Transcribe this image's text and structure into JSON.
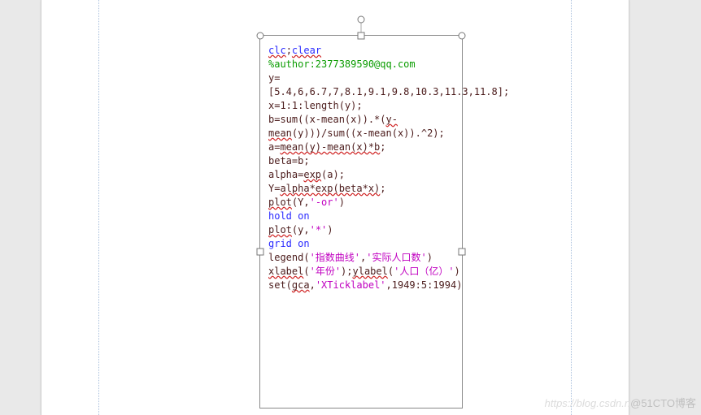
{
  "code": {
    "l1a": "clc",
    "l1b": ";",
    "l1c": "clear",
    "l2": "%author:2377389590@qq.com",
    "l3": "y=",
    "l4": "[5.4,6,6.7,7,8.1,9.1,9.8,10.3,11.3,11.8];",
    "l5a": "x=1:1:length(y);",
    "l6a": "b=sum((x-mean(x)).*(",
    "l6b": "y-mean",
    "l6c": "(y)))/sum((x-mean(x)).^2);",
    "l7a": "a=",
    "l7b": "mean(y)-mean(x)*b",
    "l7c": ";",
    "l8": "beta=b;",
    "l9a": "alpha=",
    "l9b": "exp",
    "l9c": "(a);",
    "l10a": "Y=",
    "l10b": "alpha*exp(beta*x)",
    "l10c": ";",
    "l11a_fn": "plot",
    "l11a_args": "(Y,",
    "l11a_str": "'-or'",
    "l11a_end": ")",
    "l12a": "hold ",
    "l12b": "on",
    "l13a_fn": "plot",
    "l13a_args": "(y,",
    "l13a_str": "'*'",
    "l13a_end": ")",
    "l14a": "grid ",
    "l14b": "on",
    "l15a": "legend(",
    "l15b": "'指数曲线'",
    "l15c": ",",
    "l15d": "'实际人口数'",
    "l15e": ")",
    "l16a": "xlabel",
    "l16b": "(",
    "l16c": "'年份'",
    "l16d": ");",
    "l16e": "ylabel",
    "l16f": "(",
    "l16g": "'人口（亿）'",
    "l16h": ")",
    "l17a": "set(",
    "l17b": "gca",
    "l17c": ",",
    "l17d": "'XTicklabel'",
    "l17e": ",1949:5:1994)"
  },
  "watermark": {
    "faded": "https://blog.csdn.n",
    "main": "@51CTO博客"
  }
}
